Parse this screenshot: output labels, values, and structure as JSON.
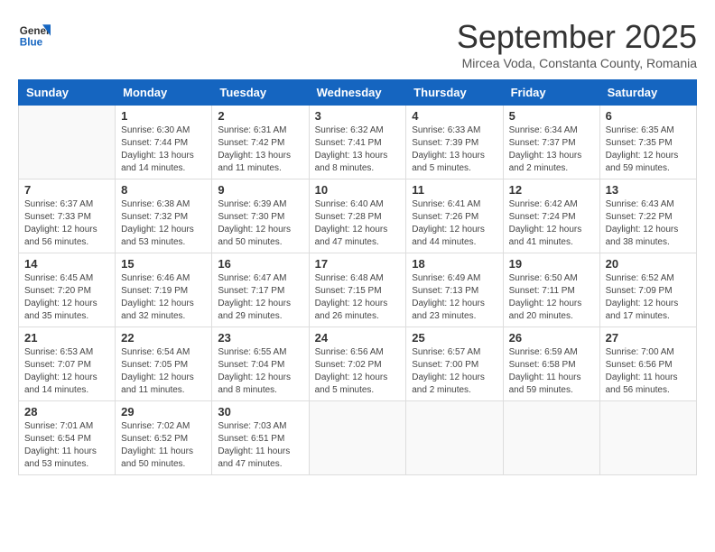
{
  "header": {
    "logo_general": "General",
    "logo_blue": "Blue",
    "month_year": "September 2025",
    "subtitle": "Mircea Voda, Constanta County, Romania"
  },
  "weekdays": [
    "Sunday",
    "Monday",
    "Tuesday",
    "Wednesday",
    "Thursday",
    "Friday",
    "Saturday"
  ],
  "weeks": [
    [
      {
        "day": "",
        "sunrise": "",
        "sunset": "",
        "daylight": ""
      },
      {
        "day": "1",
        "sunrise": "6:30 AM",
        "sunset": "7:44 PM",
        "daylight": "13 hours and 14 minutes."
      },
      {
        "day": "2",
        "sunrise": "6:31 AM",
        "sunset": "7:42 PM",
        "daylight": "13 hours and 11 minutes."
      },
      {
        "day": "3",
        "sunrise": "6:32 AM",
        "sunset": "7:41 PM",
        "daylight": "13 hours and 8 minutes."
      },
      {
        "day": "4",
        "sunrise": "6:33 AM",
        "sunset": "7:39 PM",
        "daylight": "13 hours and 5 minutes."
      },
      {
        "day": "5",
        "sunrise": "6:34 AM",
        "sunset": "7:37 PM",
        "daylight": "13 hours and 2 minutes."
      },
      {
        "day": "6",
        "sunrise": "6:35 AM",
        "sunset": "7:35 PM",
        "daylight": "12 hours and 59 minutes."
      }
    ],
    [
      {
        "day": "7",
        "sunrise": "6:37 AM",
        "sunset": "7:33 PM",
        "daylight": "12 hours and 56 minutes."
      },
      {
        "day": "8",
        "sunrise": "6:38 AM",
        "sunset": "7:32 PM",
        "daylight": "12 hours and 53 minutes."
      },
      {
        "day": "9",
        "sunrise": "6:39 AM",
        "sunset": "7:30 PM",
        "daylight": "12 hours and 50 minutes."
      },
      {
        "day": "10",
        "sunrise": "6:40 AM",
        "sunset": "7:28 PM",
        "daylight": "12 hours and 47 minutes."
      },
      {
        "day": "11",
        "sunrise": "6:41 AM",
        "sunset": "7:26 PM",
        "daylight": "12 hours and 44 minutes."
      },
      {
        "day": "12",
        "sunrise": "6:42 AM",
        "sunset": "7:24 PM",
        "daylight": "12 hours and 41 minutes."
      },
      {
        "day": "13",
        "sunrise": "6:43 AM",
        "sunset": "7:22 PM",
        "daylight": "12 hours and 38 minutes."
      }
    ],
    [
      {
        "day": "14",
        "sunrise": "6:45 AM",
        "sunset": "7:20 PM",
        "daylight": "12 hours and 35 minutes."
      },
      {
        "day": "15",
        "sunrise": "6:46 AM",
        "sunset": "7:19 PM",
        "daylight": "12 hours and 32 minutes."
      },
      {
        "day": "16",
        "sunrise": "6:47 AM",
        "sunset": "7:17 PM",
        "daylight": "12 hours and 29 minutes."
      },
      {
        "day": "17",
        "sunrise": "6:48 AM",
        "sunset": "7:15 PM",
        "daylight": "12 hours and 26 minutes."
      },
      {
        "day": "18",
        "sunrise": "6:49 AM",
        "sunset": "7:13 PM",
        "daylight": "12 hours and 23 minutes."
      },
      {
        "day": "19",
        "sunrise": "6:50 AM",
        "sunset": "7:11 PM",
        "daylight": "12 hours and 20 minutes."
      },
      {
        "day": "20",
        "sunrise": "6:52 AM",
        "sunset": "7:09 PM",
        "daylight": "12 hours and 17 minutes."
      }
    ],
    [
      {
        "day": "21",
        "sunrise": "6:53 AM",
        "sunset": "7:07 PM",
        "daylight": "12 hours and 14 minutes."
      },
      {
        "day": "22",
        "sunrise": "6:54 AM",
        "sunset": "7:05 PM",
        "daylight": "12 hours and 11 minutes."
      },
      {
        "day": "23",
        "sunrise": "6:55 AM",
        "sunset": "7:04 PM",
        "daylight": "12 hours and 8 minutes."
      },
      {
        "day": "24",
        "sunrise": "6:56 AM",
        "sunset": "7:02 PM",
        "daylight": "12 hours and 5 minutes."
      },
      {
        "day": "25",
        "sunrise": "6:57 AM",
        "sunset": "7:00 PM",
        "daylight": "12 hours and 2 minutes."
      },
      {
        "day": "26",
        "sunrise": "6:59 AM",
        "sunset": "6:58 PM",
        "daylight": "11 hours and 59 minutes."
      },
      {
        "day": "27",
        "sunrise": "7:00 AM",
        "sunset": "6:56 PM",
        "daylight": "11 hours and 56 minutes."
      }
    ],
    [
      {
        "day": "28",
        "sunrise": "7:01 AM",
        "sunset": "6:54 PM",
        "daylight": "11 hours and 53 minutes."
      },
      {
        "day": "29",
        "sunrise": "7:02 AM",
        "sunset": "6:52 PM",
        "daylight": "11 hours and 50 minutes."
      },
      {
        "day": "30",
        "sunrise": "7:03 AM",
        "sunset": "6:51 PM",
        "daylight": "11 hours and 47 minutes."
      },
      {
        "day": "",
        "sunrise": "",
        "sunset": "",
        "daylight": ""
      },
      {
        "day": "",
        "sunrise": "",
        "sunset": "",
        "daylight": ""
      },
      {
        "day": "",
        "sunrise": "",
        "sunset": "",
        "daylight": ""
      },
      {
        "day": "",
        "sunrise": "",
        "sunset": "",
        "daylight": ""
      }
    ]
  ]
}
